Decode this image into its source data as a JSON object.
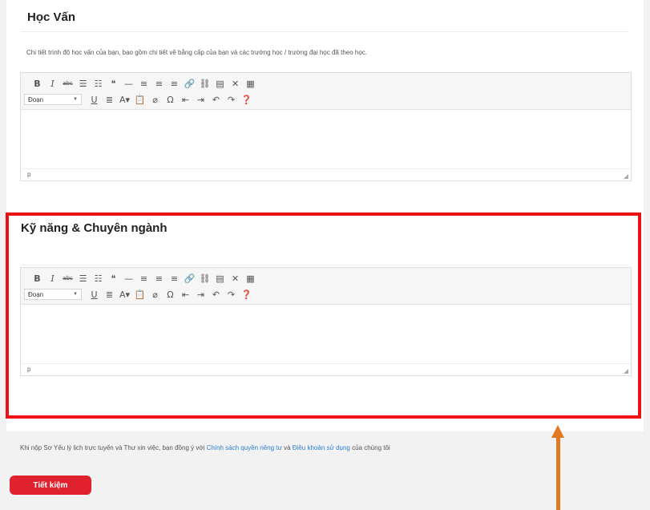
{
  "education": {
    "title": "Học Vấn",
    "description": "Chi tiết trình độ học vấn của bạn, bao gồm chi tiết về bằng cấp của bạn và các trường học / trường đại học đã theo học.",
    "editor": {
      "format_value": "Đoạn",
      "status_path": "p"
    }
  },
  "skills": {
    "title": "Kỹ năng & Chuyên ngành",
    "editor": {
      "format_value": "Đoạn",
      "status_path": "p"
    }
  },
  "consent": {
    "prefix": "Khi nộp Sơ Yếu lý lịch trực tuyến và Thư xin việc, bạn đồng ý với ",
    "privacy_link": "Chính sách quyền riêng tư",
    "middle": " và ",
    "terms_link": "Điều khoản sử dụng",
    "suffix": " của chúng tôi"
  },
  "save_button": "Tiết kiệm",
  "toolbar": {
    "row1": [
      {
        "name": "bold-icon",
        "glyph": "B"
      },
      {
        "name": "italic-icon",
        "glyph": "I"
      },
      {
        "name": "strikethrough-icon",
        "glyph": "abc"
      },
      {
        "name": "bullet-list-icon",
        "glyph": "☰"
      },
      {
        "name": "numbered-list-icon",
        "glyph": "☷"
      },
      {
        "name": "blockquote-icon",
        "glyph": "❝"
      },
      {
        "name": "horizontal-line-icon",
        "glyph": "—"
      },
      {
        "name": "align-left-icon",
        "glyph": "≡"
      },
      {
        "name": "align-center-icon",
        "glyph": "≡"
      },
      {
        "name": "align-right-icon",
        "glyph": "≡"
      },
      {
        "name": "link-icon",
        "glyph": "🔗"
      },
      {
        "name": "unlink-icon",
        "glyph": "⛓"
      },
      {
        "name": "read-more-icon",
        "glyph": "▤"
      },
      {
        "name": "fullscreen-icon",
        "glyph": "✕"
      },
      {
        "name": "toolbar-toggle-icon",
        "glyph": "▦"
      }
    ],
    "row2": [
      {
        "name": "underline-icon",
        "glyph": "U"
      },
      {
        "name": "justify-icon",
        "glyph": "≣"
      },
      {
        "name": "text-color-icon",
        "glyph": "A▾"
      },
      {
        "name": "paste-text-icon",
        "glyph": "📋"
      },
      {
        "name": "clear-formatting-icon",
        "glyph": "⌀"
      },
      {
        "name": "special-character-icon",
        "glyph": "Ω"
      },
      {
        "name": "outdent-icon",
        "glyph": "⇤"
      },
      {
        "name": "indent-icon",
        "glyph": "⇥"
      },
      {
        "name": "undo-icon",
        "glyph": "↶"
      },
      {
        "name": "redo-icon",
        "glyph": "↷"
      },
      {
        "name": "help-icon",
        "glyph": "❓"
      }
    ]
  },
  "colors": {
    "accent_red": "#e0222e",
    "link_blue": "#2a7fd4",
    "arrow_orange": "#e07a22"
  }
}
